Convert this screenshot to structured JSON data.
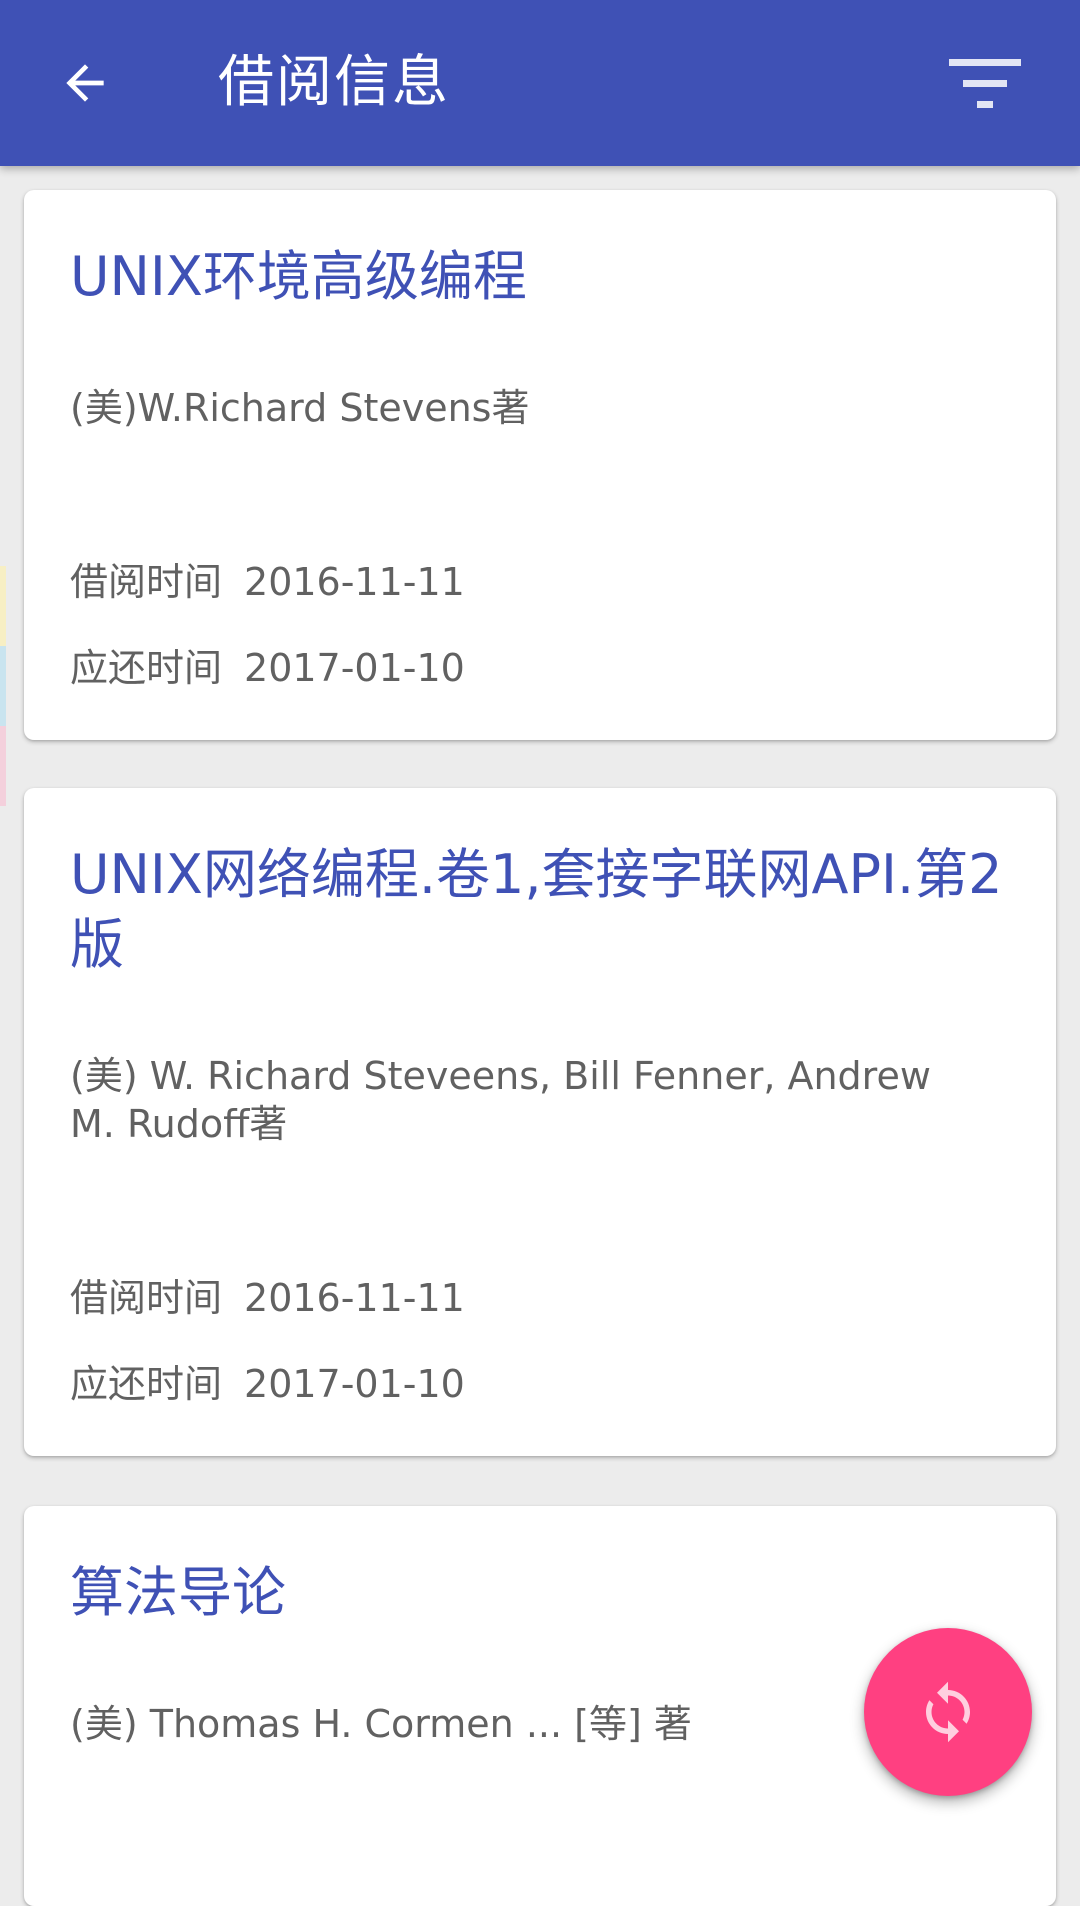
{
  "appbar": {
    "title": "借阅信息",
    "back_icon": "arrow-back-icon",
    "filter_icon": "filter-icon",
    "color": "#3f51b5"
  },
  "books": [
    {
      "title": "UNIX环境高级编程",
      "author": "(美)W.Richard Stevens著",
      "borrow_label": "借阅时间",
      "borrow_date": "2016-11-11",
      "due_label": "应还时间",
      "due_date": "2017-01-10"
    },
    {
      "title": "UNIX网络编程.卷1,套接字联网API.第2版",
      "author": "(美) W. Richard Steveens, Bill Fenner, Andrew M. Rudoff著",
      "borrow_label": "借阅时间",
      "borrow_date": "2016-11-11",
      "due_label": "应还时间",
      "due_date": "2017-01-10"
    },
    {
      "title": "算法导论",
      "author": "(美) Thomas H. Cormen ... [等] 著"
    }
  ],
  "fab": {
    "icon": "refresh-icon",
    "color": "#ff4081"
  },
  "colors": {
    "title_text": "#3f51b5",
    "body_text": "#616161",
    "background": "#ececec",
    "edge_strip": [
      "#f7efc4",
      "#c9e4ef",
      "#f4d0dc"
    ]
  }
}
